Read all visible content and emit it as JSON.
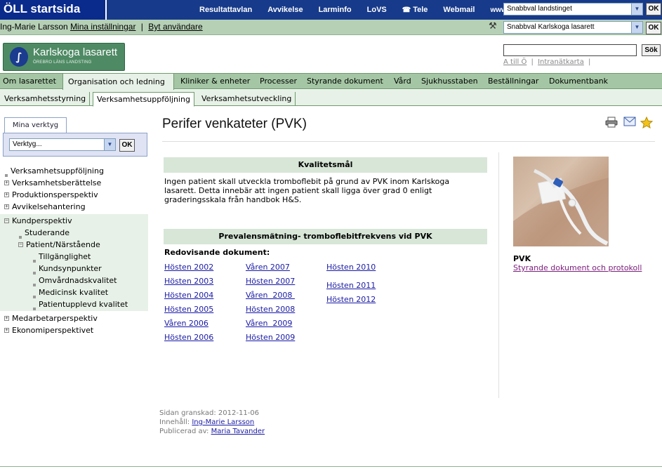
{
  "brand": "ÖLL startsida",
  "top_nav": [
    "Resultattavlan",
    "Avvikelse",
    "Larminfo",
    "LoVS",
    "Tele",
    "Webmail",
    "www"
  ],
  "top_select": {
    "value": "Snabbval landstinget",
    "ok": "OK"
  },
  "user": {
    "name": "Ing-Marie Larsson",
    "settings": "Mina inställningar",
    "switch": "Byt användare",
    "sep": "|"
  },
  "hospital_select": {
    "value": "Snabbval Karlskoga lasarett",
    "ok": "OK"
  },
  "logo": {
    "name": "Karlskoga lasarett",
    "sub": "ÖREBRO LÄNS LANDSTING"
  },
  "search": {
    "button": "Sök",
    "links": [
      "A till Ö",
      "Intranätkarta"
    ],
    "sep": "|"
  },
  "main_nav": [
    "Om lasarettet",
    "Organisation och ledning",
    "Kliniker & enheter",
    "Processer",
    "Styrande dokument",
    "Vård",
    "Sjukhusstaben",
    "Beställningar",
    "Dokumentbank"
  ],
  "sub_nav": [
    "Verksamhetsstyrning",
    "Verksamhetsuppföljning",
    "Verksamhetsutveckling"
  ],
  "tools": {
    "tab": "Mina verktyg",
    "select": "Verktyg...",
    "ok": "OK"
  },
  "tree": [
    "Verksamhetsuppföljning",
    "Verksamhetsberättelse",
    "Produktionsperspektiv",
    "Avvikelsehantering",
    "Kundperspektiv",
    "Studerande",
    "Patient/Närstående",
    "Tillgänglighet",
    "Kundsynpunkter",
    "Omvårdnadskvalitet",
    "Medicinsk kvalitet",
    "Patientupplevd kvalitet",
    "Medarbetarperspektiv",
    "Ekonomiperspektivet"
  ],
  "page": {
    "title": "Perifer venkateter (PVK)",
    "goal_heading": "Kvalitetsmål",
    "goal_text": "Ingen patient skall utveckla tromboflebit på grund av PVK inom Karlskoga lasarett. Detta innebär att ingen patient skall ligga över grad 0 enligt graderingsskala från handbok H&S.",
    "prevalence_heading": "Prevalensmätning- tromboflebitfrekvens vid PVK",
    "docs_heading": "Redovisande dokument:",
    "docs": [
      [
        "Hösten 2002",
        "Hösten 2003",
        "Hösten 2004",
        "Hösten 2005",
        "Våren  2006",
        "Hösten 2006"
      ],
      [
        "Våren 2007",
        "Hösten 2007",
        "Våren  2008 ",
        "Hösten 2008",
        "Våren  2009",
        "Hösten 2009"
      ],
      [
        "Hösten 2010",
        "Hösten 2011",
        "Hösten 2012"
      ]
    ]
  },
  "aside": {
    "title": "PVK",
    "link": "Styrande dokument och protokoll"
  },
  "footer": {
    "reviewed_label": "Sidan granskad:",
    "reviewed": "2012-11-06",
    "content_label": "Innehåll:",
    "content": "Ing-Marie Larsson",
    "published_label": "Publicerad av:",
    "published": "Maria Tavander"
  }
}
